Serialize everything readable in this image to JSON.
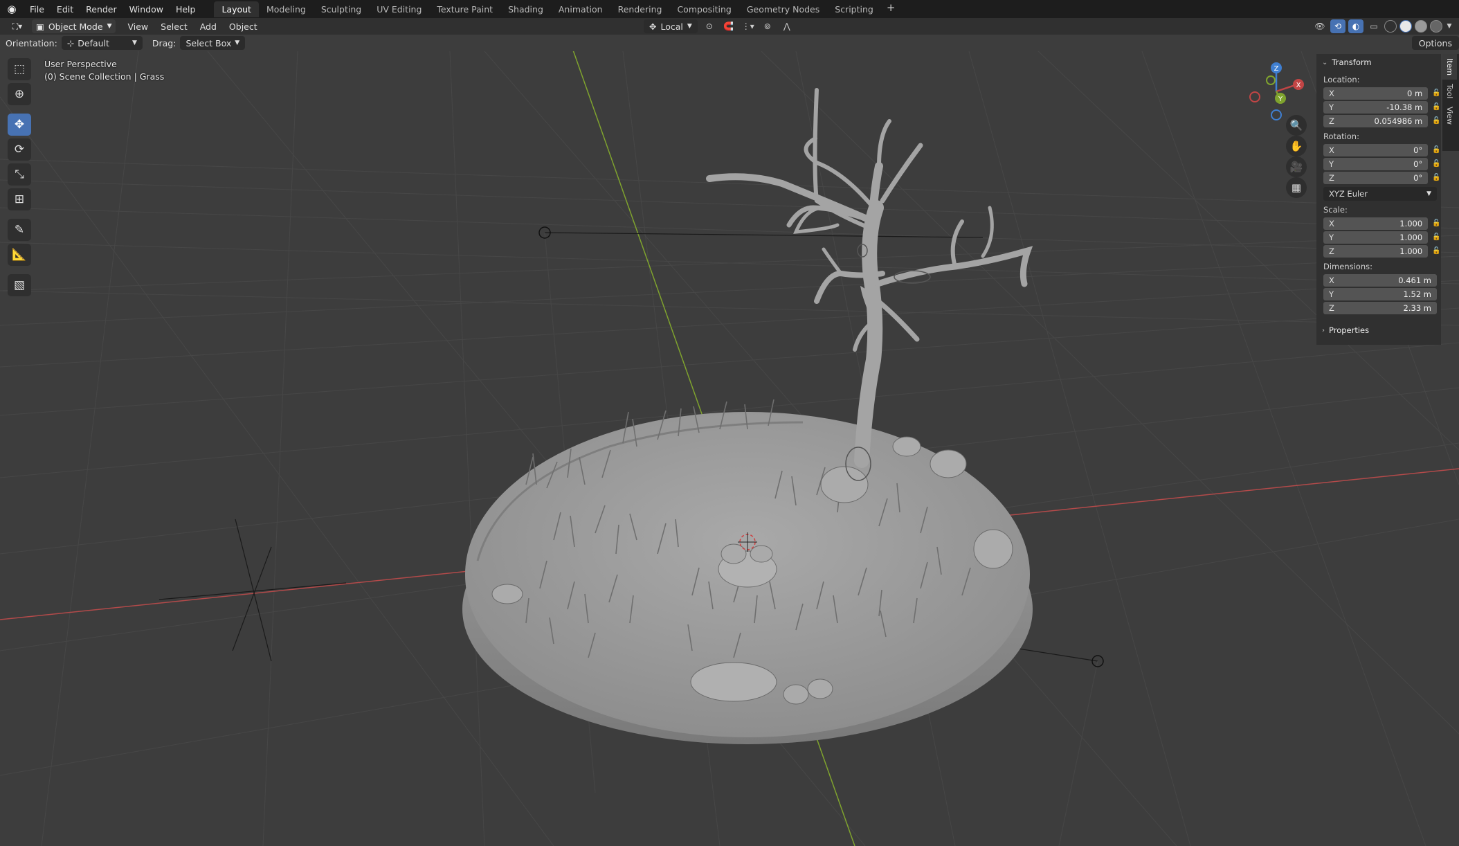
{
  "topbar": {
    "menus": [
      "File",
      "Edit",
      "Render",
      "Window",
      "Help"
    ],
    "workspaces": [
      "Layout",
      "Modeling",
      "Sculpting",
      "UV Editing",
      "Texture Paint",
      "Shading",
      "Animation",
      "Rendering",
      "Compositing",
      "Geometry Nodes",
      "Scripting"
    ],
    "active_workspace": "Layout",
    "add_workspace": "+"
  },
  "header": {
    "mode": "Object Mode",
    "menus": [
      "View",
      "Select",
      "Add",
      "Object"
    ],
    "transform_space": "Local"
  },
  "tool_settings": {
    "orientation_label": "Orientation:",
    "orientation_value": "Default",
    "drag_label": "Drag:",
    "drag_value": "Select Box",
    "options_label": "Options"
  },
  "viewport": {
    "view_name": "User Perspective",
    "collection_info": "(0) Scene Collection | Grass",
    "gizmo_axes": {
      "x": "X",
      "y": "Y",
      "z": "Z"
    }
  },
  "npanel": {
    "section": "Transform",
    "location_label": "Location:",
    "location": [
      {
        "axis": "X",
        "value": "0 m"
      },
      {
        "axis": "Y",
        "value": "-10.38 m"
      },
      {
        "axis": "Z",
        "value": "0.054986 m"
      }
    ],
    "rotation_label": "Rotation:",
    "rotation": [
      {
        "axis": "X",
        "value": "0°"
      },
      {
        "axis": "Y",
        "value": "0°"
      },
      {
        "axis": "Z",
        "value": "0°"
      }
    ],
    "rotation_mode": "XYZ Euler",
    "scale_label": "Scale:",
    "scale": [
      {
        "axis": "X",
        "value": "1.000"
      },
      {
        "axis": "Y",
        "value": "1.000"
      },
      {
        "axis": "Z",
        "value": "1.000"
      }
    ],
    "dimensions_label": "Dimensions:",
    "dimensions": [
      {
        "axis": "X",
        "value": "0.461 m"
      },
      {
        "axis": "Y",
        "value": "1.52 m"
      },
      {
        "axis": "Z",
        "value": "2.33 m"
      }
    ],
    "properties_label": "Properties",
    "tabs": [
      "Item",
      "Tool",
      "View"
    ]
  },
  "colors": {
    "accent": "#4772b3",
    "x_axis": "#b34a4a",
    "y_axis": "#7fa32e",
    "z_axis": "#3f7fd1"
  }
}
